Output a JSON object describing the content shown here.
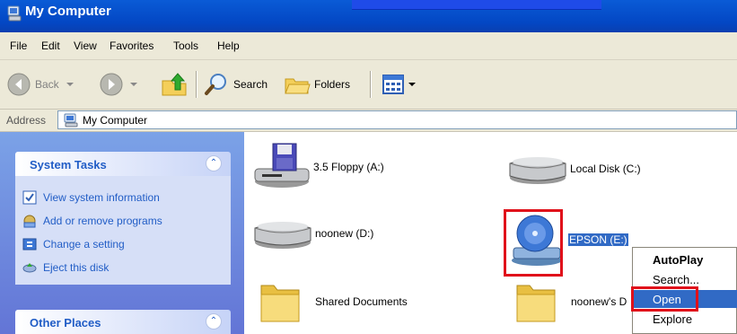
{
  "window": {
    "title": "My Computer"
  },
  "menu": [
    "File",
    "Edit",
    "View",
    "Favorites",
    "Tools",
    "Help"
  ],
  "toolbar": {
    "back": "Back",
    "search": "Search",
    "folders": "Folders"
  },
  "address": {
    "label": "Address",
    "value": "My Computer"
  },
  "left_pane": {
    "system_tasks": {
      "title": "System Tasks",
      "items": [
        "View system information",
        "Add or remove programs",
        "Change a setting",
        "Eject this disk"
      ]
    },
    "other_places": {
      "title": "Other Places"
    }
  },
  "drives": [
    {
      "label": "3.5 Floppy (A:)",
      "icon": "floppy-drive-icon"
    },
    {
      "label": "Local Disk (C:)",
      "icon": "hard-disk-icon"
    },
    {
      "label": "noonew (D:)",
      "icon": "hard-disk-icon"
    },
    {
      "label": "EPSON (E:)",
      "icon": "cd-drive-icon",
      "selected": true
    },
    {
      "label": "Shared Documents",
      "icon": "folder-icon"
    },
    {
      "label": "noonew's D",
      "icon": "folder-icon"
    }
  ],
  "context_menu": {
    "items": [
      "AutoPlay",
      "Search...",
      "Open",
      "Explore"
    ],
    "highlighted": "Open"
  },
  "colors": {
    "xp_blue": "#0347c4",
    "highlight": "#316ac5",
    "annotation_red": "#e0101a",
    "task_link": "#215dc6"
  }
}
